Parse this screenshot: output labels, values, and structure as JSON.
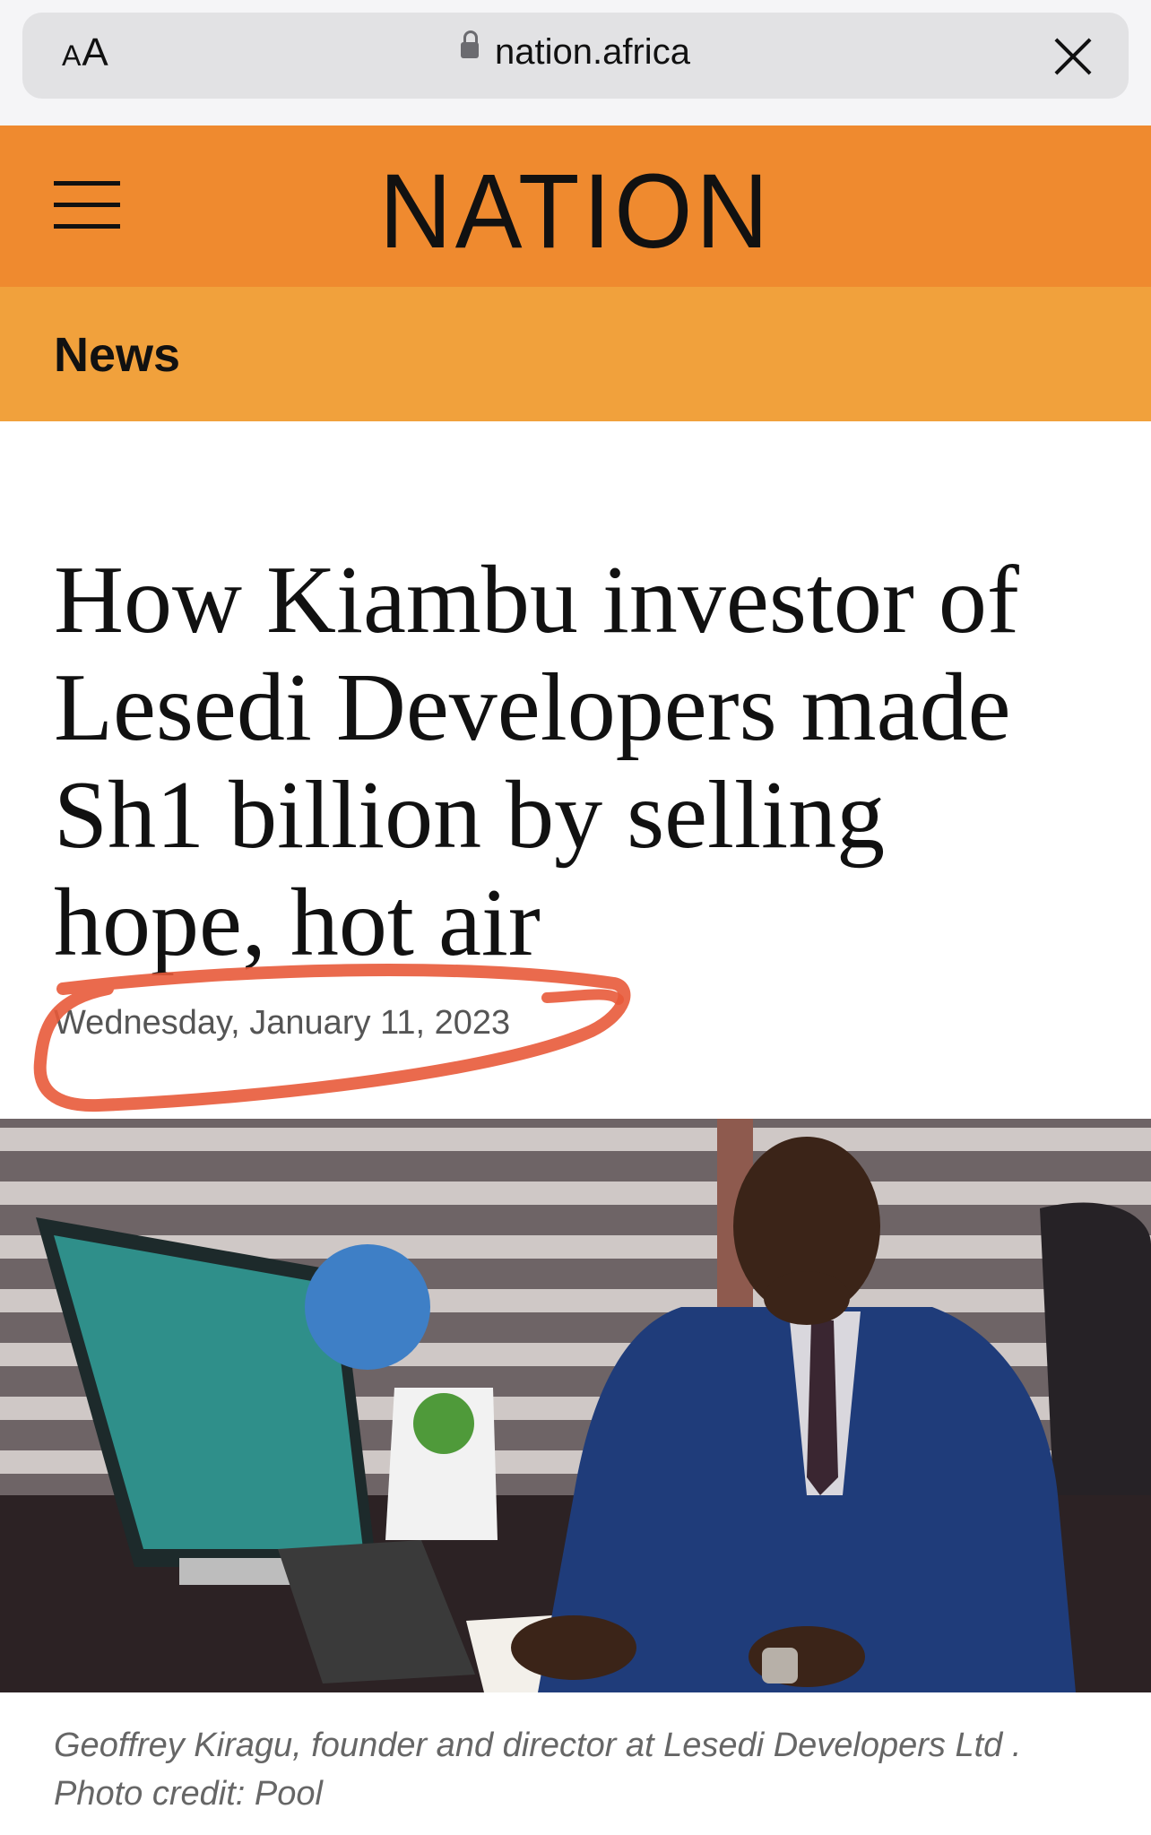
{
  "browser": {
    "text_size_button": "AA",
    "url": "nation.africa"
  },
  "header": {
    "logo": "NATION",
    "section": "News"
  },
  "article": {
    "headline": "How Kiambu investor of Lesedi Developers made Sh1 billion by selling hope, hot air",
    "date": "Wednesday, January 11, 2023",
    "caption_line1": "Geoffrey Kiragu, founder and director at Lesedi Developers Ltd .",
    "caption_line2": "Photo credit: Pool"
  },
  "colors": {
    "masthead": "#ef8a2f",
    "section_bar": "#f1a13c",
    "annotation": "#e85a3a"
  },
  "icons": [
    "lock-icon",
    "close-icon",
    "hamburger-menu-icon"
  ]
}
